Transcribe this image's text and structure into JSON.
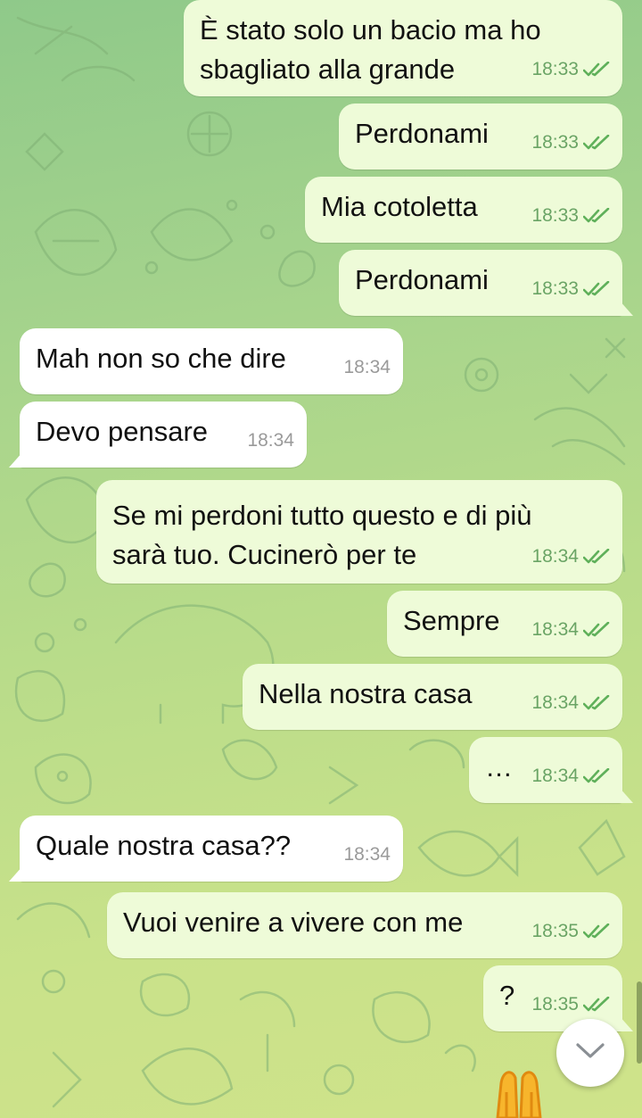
{
  "messages": [
    {
      "dir": "out",
      "lines": [
        "È stato solo un bacio ma ho",
        "sbagliato alla grande"
      ],
      "time": "18:33",
      "read": true
    },
    {
      "dir": "out",
      "lines": [
        "Perdonami"
      ],
      "time": "18:33",
      "read": true
    },
    {
      "dir": "out",
      "lines": [
        "Mia cotoletta"
      ],
      "time": "18:33",
      "read": true
    },
    {
      "dir": "out",
      "lines": [
        "Perdonami"
      ],
      "time": "18:33",
      "read": true
    },
    {
      "dir": "in",
      "lines": [
        "Mah non so che dire"
      ],
      "time": "18:34"
    },
    {
      "dir": "in",
      "lines": [
        "Devo pensare"
      ],
      "time": "18:34"
    },
    {
      "dir": "out",
      "lines": [
        "Se mi perdoni tutto questo e di più",
        "sarà tuo. Cucinerò per te"
      ],
      "time": "18:34",
      "read": true
    },
    {
      "dir": "out",
      "lines": [
        "Sempre"
      ],
      "time": "18:34",
      "read": true
    },
    {
      "dir": "out",
      "lines": [
        "Nella nostra casa"
      ],
      "time": "18:34",
      "read": true
    },
    {
      "dir": "out",
      "lines": [
        "…"
      ],
      "time": "18:34",
      "read": true
    },
    {
      "dir": "in",
      "lines": [
        "Quale nostra casa??"
      ],
      "time": "18:34"
    },
    {
      "dir": "out",
      "lines": [
        "Vuoi venire a vivere con me"
      ],
      "time": "18:35",
      "read": true
    },
    {
      "dir": "out",
      "lines": [
        "?"
      ],
      "time": "18:35",
      "read": true
    }
  ],
  "icons": {
    "read_receipt": "double-check-icon",
    "scroll_down": "chevron-down-icon",
    "reaction": "praying-hands-emoji-icon"
  },
  "colors": {
    "outgoing_bubble": "#eefbd8",
    "incoming_bubble": "#ffffff",
    "check_color": "#5fb05a",
    "wallpaper_top": "#8fc98a",
    "wallpaper_bottom": "#cfe38a"
  }
}
